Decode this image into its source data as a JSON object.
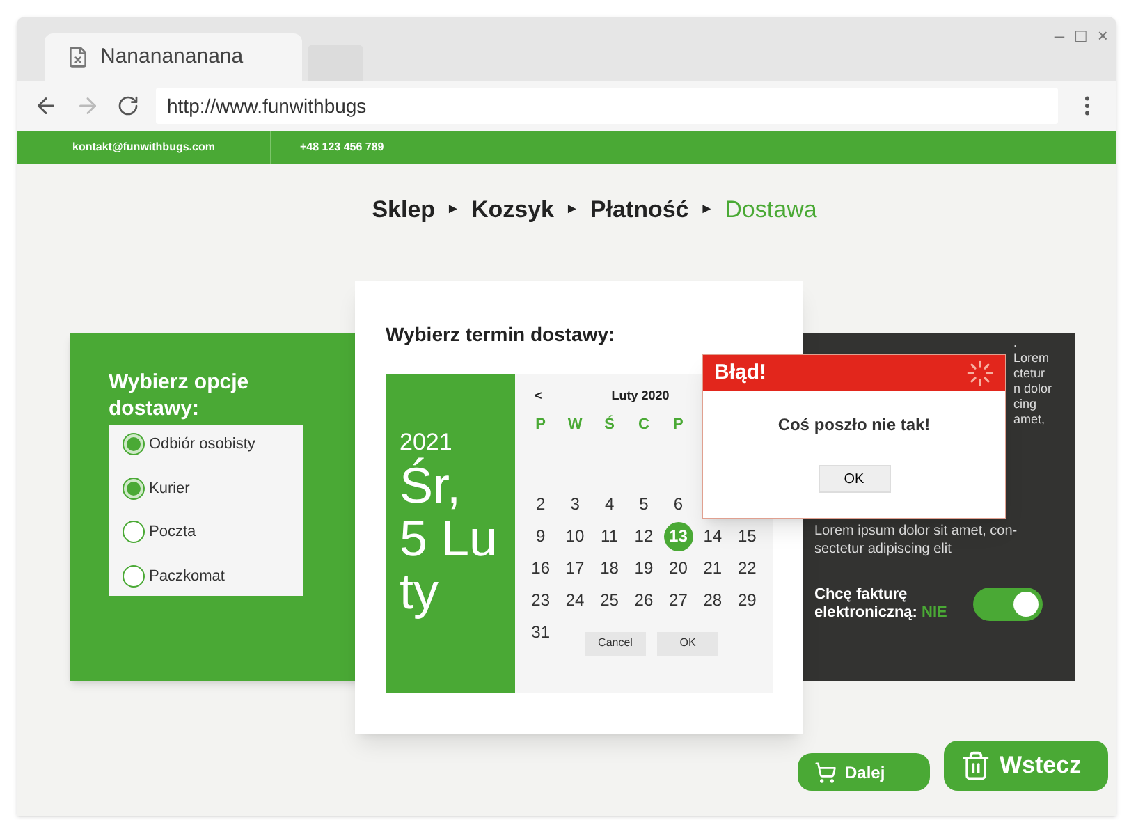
{
  "window": {
    "controls": [
      "–",
      "□",
      "×"
    ]
  },
  "tabs": [
    {
      "title": "Nananananana",
      "selected": true
    }
  ],
  "address_bar": {
    "url": "http://www.funwithbugs"
  },
  "top_bar": {
    "email": "kontakt@funwithbugs.com",
    "phone": "+48 123 456 789"
  },
  "breadcrumb": [
    {
      "label": "Sklep",
      "selected": false
    },
    {
      "label": "Kozsyk",
      "selected": false
    },
    {
      "label": "Płatność",
      "selected": false
    },
    {
      "label": "Dostawa",
      "selected": true
    }
  ],
  "breadcrumb_separators": [
    "►",
    "►",
    "►"
  ],
  "delivery_options": {
    "title": "Wybierz opcje dostawy:",
    "options": [
      {
        "label": "Odbiór osobisty",
        "checked": true
      },
      {
        "label": "Kurier",
        "checked": true
      },
      {
        "label": "Poczta",
        "checked": false
      },
      {
        "label": "Paczkomat",
        "checked": false
      }
    ]
  },
  "date_picker": {
    "title": "Wybierz termin dostawy:",
    "year": "2021",
    "date": "Śr, 5 Luty",
    "prev": "<",
    "month": "Luty 2020",
    "weekdays": [
      "P",
      "W",
      "Ś",
      "C",
      "P"
    ],
    "weeks": [
      [
        {
          "d": "2",
          "selected": false
        },
        {
          "d": "3",
          "selected": false
        },
        {
          "d": "4",
          "selected": false
        },
        {
          "d": "5",
          "selected": false
        },
        {
          "d": "6",
          "selected": false
        }
      ],
      [
        {
          "d": "9",
          "selected": false
        },
        {
          "d": "10",
          "selected": false
        },
        {
          "d": "11",
          "selected": false
        },
        {
          "d": "12",
          "selected": false
        },
        {
          "d": "13",
          "selected": true
        },
        {
          "d": "14",
          "selected": false
        },
        {
          "d": "15",
          "selected": false
        }
      ],
      [
        {
          "d": "16",
          "selected": false
        },
        {
          "d": "17",
          "selected": false
        },
        {
          "d": "18",
          "selected": false
        },
        {
          "d": "19",
          "selected": false
        },
        {
          "d": "20",
          "selected": false
        },
        {
          "d": "21",
          "selected": false
        },
        {
          "d": "22",
          "selected": false
        }
      ],
      [
        {
          "d": "23",
          "selected": false
        },
        {
          "d": "24",
          "selected": false
        },
        {
          "d": "25",
          "selected": false
        },
        {
          "d": "26",
          "selected": false
        },
        {
          "d": "27",
          "selected": false
        },
        {
          "d": "28",
          "selected": false
        },
        {
          "d": "29",
          "selected": false
        }
      ],
      [
        {
          "d": "31",
          "selected": false
        }
      ]
    ],
    "buttons": [
      "Cancel",
      "OK"
    ]
  },
  "info_panel": {
    "hidden_fragments": [
      ".",
      "Lorem",
      "ctetur",
      "n dolor",
      "cing",
      "amet,"
    ],
    "text": "Lorem ipsum dolor sit amet, con-\nsectetur adipiscing elit",
    "invoice_label": "Chcę fakturę elektroniczną:",
    "invoice_value": "NIE",
    "invoice_on": true
  },
  "dialog": {
    "title": "Błąd!",
    "message": "Coś poszło nie tak!",
    "button": "OK"
  },
  "actions": [
    {
      "kind": "cart",
      "label": "Dalej"
    },
    {
      "kind": "trash",
      "label": "Wstecz"
    }
  ]
}
